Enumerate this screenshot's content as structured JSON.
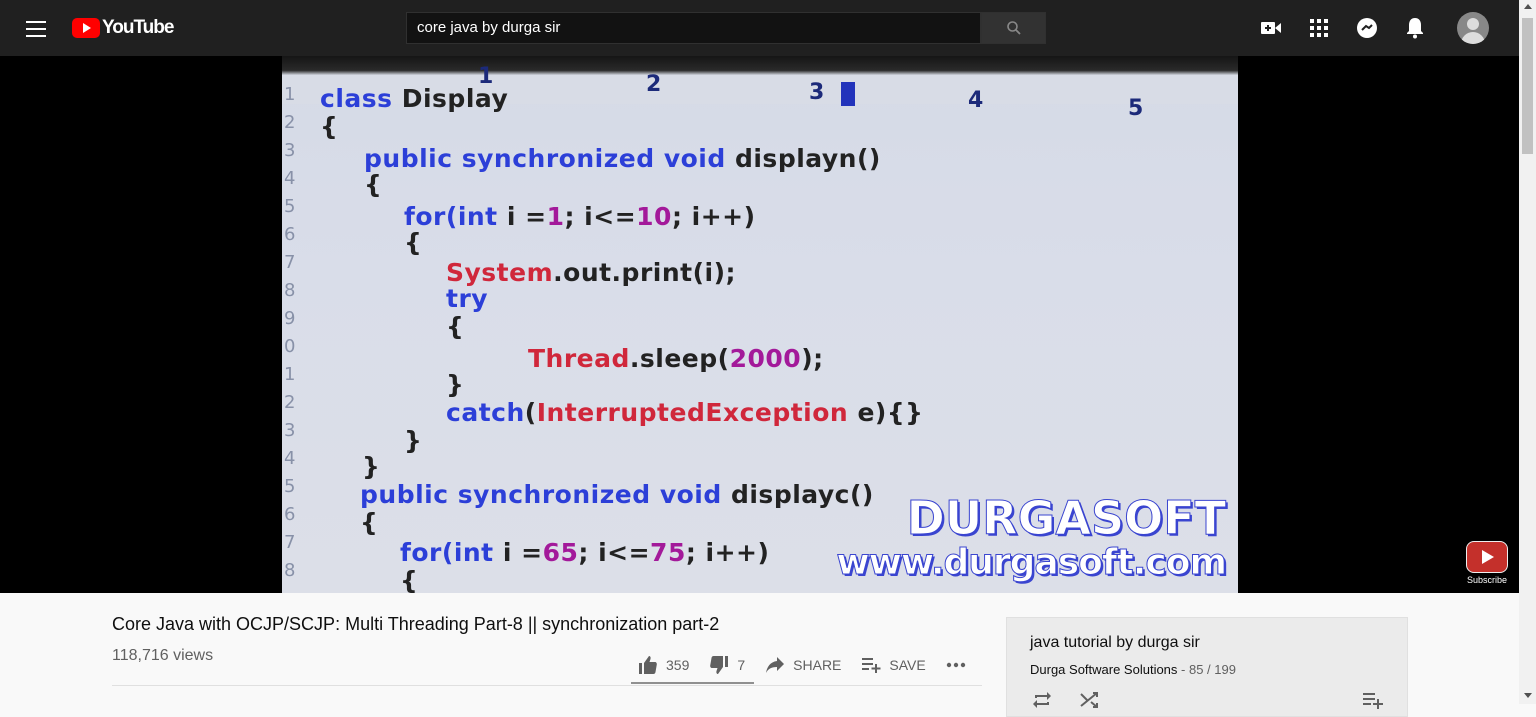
{
  "header": {
    "logo_text": "YouTube",
    "search_value": "core java by durga sir",
    "icons": [
      "menu-icon",
      "create-video-icon",
      "apps-icon",
      "messages-icon",
      "notifications-icon",
      "account-avatar"
    ]
  },
  "video_frame": {
    "ruler_numbers": [
      "1",
      "2",
      "3",
      "4",
      "5"
    ],
    "line_numbers": [
      "1",
      "2",
      "3",
      "4",
      "5",
      "6",
      "7",
      "8",
      "9",
      "0",
      "1",
      "2",
      "3",
      "4",
      "5",
      "6",
      "7",
      "8"
    ],
    "code": {
      "l1_kw": "class",
      "l1_rest": " Display",
      "l2": "{",
      "l3_kw": "public synchronized void",
      "l3_rest": " displayn()",
      "l4": "{",
      "l5_kw1": "for(",
      "l5_kw2": "int",
      "l5_a": " i =",
      "l5_n1": "1",
      "l5_b": "; i<=",
      "l5_n2": "10",
      "l5_c": "; i++)",
      "l6": "{",
      "l7_cls": "System",
      "l7_rest": ".out.print(i);",
      "l8_kw": "try",
      "l9": "{",
      "l10_cls": "Thread",
      "l10_a": ".sleep(",
      "l10_n": "2000",
      "l10_b": ");",
      "l11": "}",
      "l12_kw": "catch",
      "l12_a": "(",
      "l12_cls": "InterruptedException",
      "l12_b": " e){}",
      "l13": "}",
      "l14": "}",
      "l15_kw": "public synchronized void",
      "l15_rest": " displayc()",
      "l16": "{",
      "l17_kw1": "for(",
      "l17_kw2": "int",
      "l17_a": " i =",
      "l17_n1": "65",
      "l17_b": "; i<=",
      "l17_n2": "75",
      "l17_c": "; i++)",
      "l18": "{"
    },
    "watermark_line1": "DURGASOFT",
    "watermark_line2": "www.durgasoft.com"
  },
  "subscribe_watermark": {
    "label": "Subscribe"
  },
  "video_info": {
    "title": "Core Java with OCJP/SCJP: Multi Threading Part-8 || synchronization part-2",
    "views": "118,716 views",
    "likes": "359",
    "dislikes": "7",
    "share_label": "SHARE",
    "save_label": "SAVE",
    "like_ratio": 0.98
  },
  "playlist": {
    "title": "java tutorial by durga sir",
    "channel": "Durga Software Solutions",
    "position": "85 / 199",
    "separator": " - "
  }
}
